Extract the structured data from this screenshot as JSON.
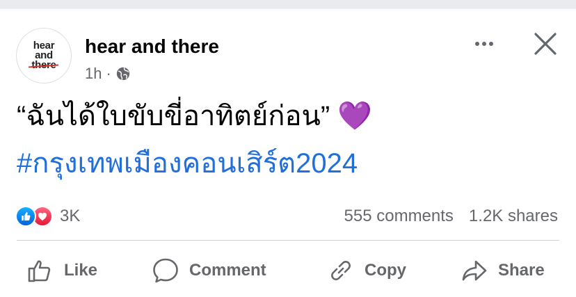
{
  "post": {
    "author": {
      "name": "hear and there",
      "avatar_logo": [
        "hear",
        "and",
        "there"
      ]
    },
    "timestamp": "1h",
    "separator": "·",
    "audience_icon": "globe-icon",
    "text": "“ฉันได้ใบขับขี่อาทิตย์ก่อน” 💜",
    "hashtag": "#กรุงเทพเมืองคอนเสิร์ต2024",
    "reactions": {
      "types": [
        "like",
        "love"
      ],
      "count": "3K"
    },
    "comments": "555 comments",
    "shares": "1.2K shares"
  },
  "actions": {
    "like": "Like",
    "comment": "Comment",
    "copy": "Copy",
    "share": "Share"
  },
  "colors": {
    "hashtag": "#216fdb",
    "muted": "#65676b",
    "like_blue": "#0866ff",
    "love_red": "#f02849"
  }
}
